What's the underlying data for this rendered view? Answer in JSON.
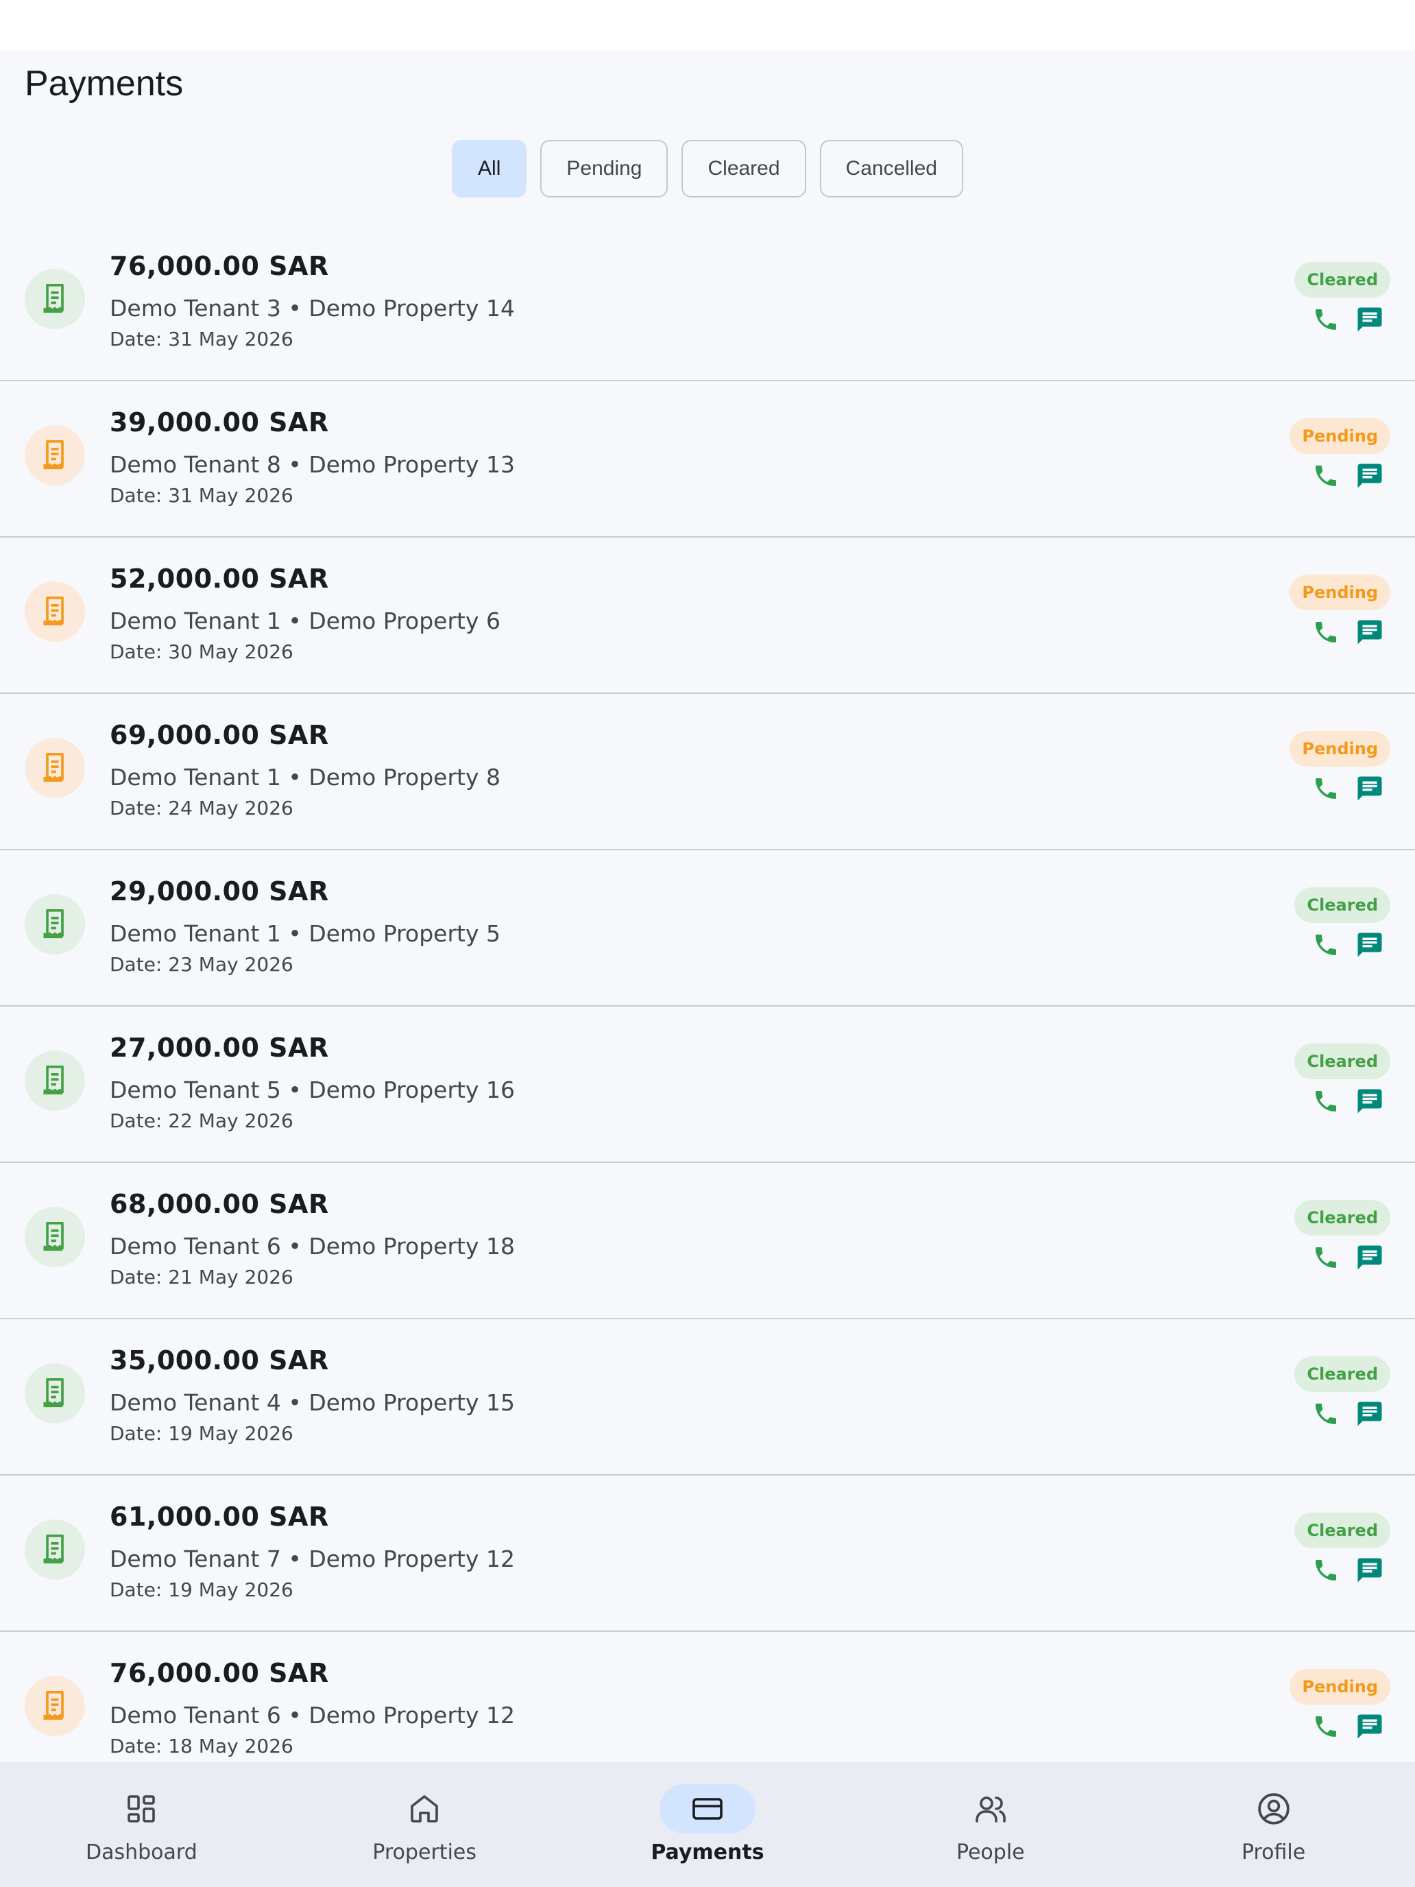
{
  "header": {
    "title": "Payments"
  },
  "filters": [
    {
      "label": "All",
      "selected": true
    },
    {
      "label": "Pending",
      "selected": false
    },
    {
      "label": "Cleared",
      "selected": false
    },
    {
      "label": "Cancelled",
      "selected": false
    }
  ],
  "payments": [
    {
      "amount": "76,000.00 SAR",
      "subtitle": "Demo Tenant 3 • Demo Property 14",
      "date": "Date: 31 May 2026",
      "status": "Cleared"
    },
    {
      "amount": "39,000.00 SAR",
      "subtitle": "Demo Tenant 8 • Demo Property 13",
      "date": "Date: 31 May 2026",
      "status": "Pending"
    },
    {
      "amount": "52,000.00 SAR",
      "subtitle": "Demo Tenant 1 • Demo Property 6",
      "date": "Date: 30 May 2026",
      "status": "Pending"
    },
    {
      "amount": "69,000.00 SAR",
      "subtitle": "Demo Tenant 1 • Demo Property 8",
      "date": "Date: 24 May 2026",
      "status": "Pending"
    },
    {
      "amount": "29,000.00 SAR",
      "subtitle": "Demo Tenant 1 • Demo Property 5",
      "date": "Date: 23 May 2026",
      "status": "Cleared"
    },
    {
      "amount": "27,000.00 SAR",
      "subtitle": "Demo Tenant 5 • Demo Property 16",
      "date": "Date: 22 May 2026",
      "status": "Cleared"
    },
    {
      "amount": "68,000.00 SAR",
      "subtitle": "Demo Tenant 6 • Demo Property 18",
      "date": "Date: 21 May 2026",
      "status": "Cleared"
    },
    {
      "amount": "35,000.00 SAR",
      "subtitle": "Demo Tenant 4 • Demo Property 15",
      "date": "Date: 19 May 2026",
      "status": "Cleared"
    },
    {
      "amount": "61,000.00 SAR",
      "subtitle": "Demo Tenant 7 • Demo Property 12",
      "date": "Date: 19 May 2026",
      "status": "Cleared"
    },
    {
      "amount": "76,000.00 SAR",
      "subtitle": "Demo Tenant 6 • Demo Property 12",
      "date": "Date: 18 May 2026",
      "status": "Pending"
    }
  ],
  "nav": [
    {
      "label": "Dashboard",
      "icon": "dashboard-icon",
      "active": false
    },
    {
      "label": "Properties",
      "icon": "home-icon",
      "active": false
    },
    {
      "label": "Payments",
      "icon": "card-icon",
      "active": true
    },
    {
      "label": "People",
      "icon": "people-icon",
      "active": false
    },
    {
      "label": "Profile",
      "icon": "profile-icon",
      "active": false
    }
  ],
  "colors": {
    "cleared": "#43a047",
    "pending": "#f39a1d",
    "accent": "#d3e4ff",
    "message": "#00897b",
    "phone": "#2e9e4f"
  }
}
